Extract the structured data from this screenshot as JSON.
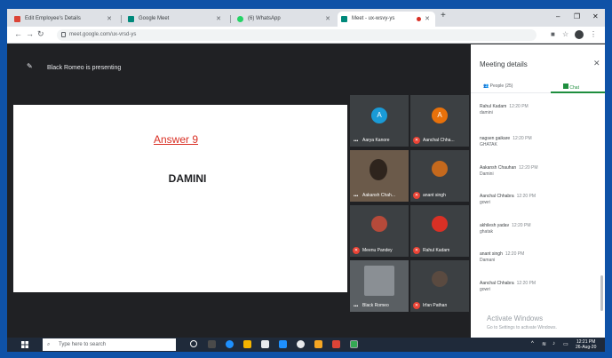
{
  "browser": {
    "tabs": [
      {
        "label": "Edit Employee's Details",
        "favicon_color": "#db4437",
        "active": false
      },
      {
        "label": "Google Meet",
        "favicon_color": "#00897b",
        "active": false
      },
      {
        "label": "(6) WhatsApp",
        "favicon_color": "#25d366",
        "active": false
      },
      {
        "label": "Meet - ux-wsvy-ys",
        "favicon_color": "#00897b",
        "active": true
      }
    ],
    "address": "meet.google.com/ux-vrsd-ys",
    "new_tab_symbol": "+",
    "minimize": "–",
    "maximize": "❐",
    "close": "✕"
  },
  "meet": {
    "presenting_text": "Black Romeo is presenting",
    "slide": {
      "heading": "Answer 9",
      "body": "DAMINI"
    },
    "participants": [
      {
        "name": "Aarya Kanore",
        "initial": "A",
        "avatar_color": "#1a9bd7",
        "muted": false
      },
      {
        "name": "Aanchal Chha...",
        "initial": "A",
        "avatar_color": "#e8710a",
        "muted": true
      },
      {
        "name": "Aakansh Chah...",
        "initial": "",
        "avatar_color": "#6b5a4a",
        "muted": false
      },
      {
        "name": "anant singh",
        "initial": "",
        "avatar_color": "#c5691d",
        "muted": true
      },
      {
        "name": "Meenu Pandey",
        "initial": "",
        "avatar_color": "#b64a3a",
        "muted": true
      },
      {
        "name": "Rahul Kadam",
        "initial": "",
        "avatar_color": "#d93025",
        "muted": true
      },
      {
        "name": "Black Romeo",
        "initial": "",
        "avatar_color": "#8a8f94",
        "muted": false
      },
      {
        "name": "Irfan Pathan",
        "initial": "",
        "avatar_color": "#5a4a40",
        "muted": true
      }
    ]
  },
  "panel": {
    "title": "Meeting details",
    "tab_people": "People (25)",
    "tab_chat": "Chat",
    "messages": [
      {
        "sender": "Rahul Kadam",
        "time": "12:20 PM",
        "text": "damini"
      },
      {
        "sender": "nagsen gaikare",
        "time": "12:20 PM",
        "text": "GHATAK"
      },
      {
        "sender": "Aakansh Chauhan",
        "time": "12:20 PM",
        "text": "Damini"
      },
      {
        "sender": "Aanchal Chhabra",
        "time": "12:20 PM",
        "text": "gowri"
      },
      {
        "sender": "akhilesh yadav",
        "time": "12:20 PM",
        "text": "ghatak"
      },
      {
        "sender": "anant singh",
        "time": "12:20 PM",
        "text": "Damani"
      },
      {
        "sender": "Aanchal Chhabra",
        "time": "12:20 PM",
        "text": "gowri"
      }
    ],
    "watermark_title": "Activate Windows",
    "watermark_sub": "Go to Settings to activate Windows."
  },
  "taskbar": {
    "search_placeholder": "Type here to search",
    "time": "12:21 PM",
    "date": "26-Aug-20",
    "apps": [
      "#4a4a4a",
      "#4a4a4a",
      "#1e90ff",
      "#f4b400",
      "#e8eaed",
      "#1e90ff",
      "#e8eaed",
      "#f5a623",
      "#db4437",
      "#34a853"
    ]
  }
}
